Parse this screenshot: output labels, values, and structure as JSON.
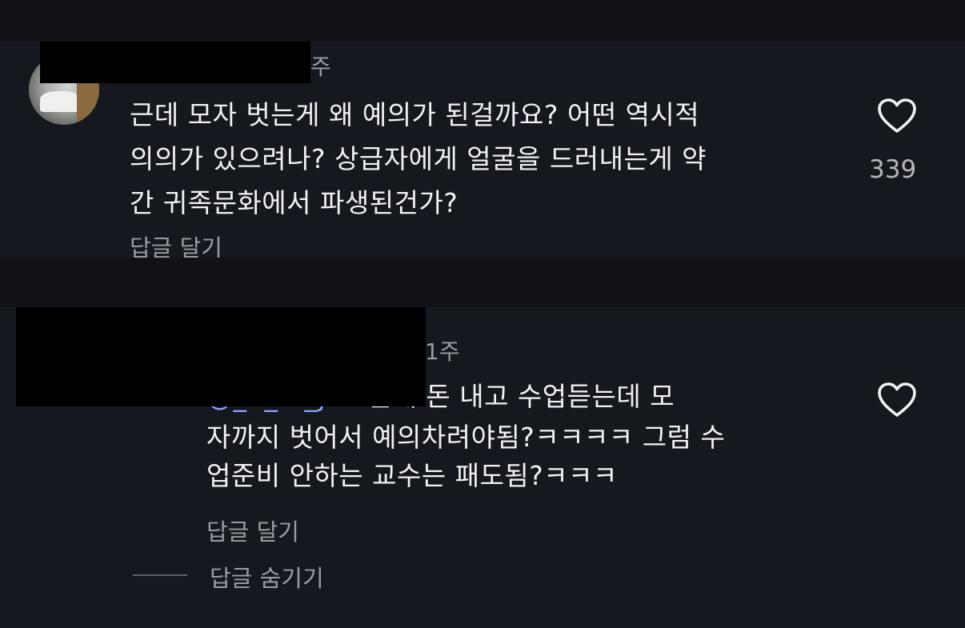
{
  "comments": [
    {
      "time": "주",
      "lines": [
        "근데 모자 벗는게 왜 예의가 된걸까요?  어떤 역시적",
        "의의가 있으려나?  상급자에게 얼굴을 드러내는게 약",
        "간 귀족문화에서 파생된건가?"
      ],
      "reply_label": "답글 달기",
      "likes": "339",
      "like_icon": "heart-outline-icon"
    },
    {
      "time": "1주",
      "mention": "@_.._..._jae",
      "lines": [
        "근데 돈 내고 수업듣는데 모",
        "자까지 벗어서 예의차려야됨?ㅋㅋㅋㅋ 그럼 수",
        "업준비 안하는 교수는 패도됨?ㅋㅋㅋ"
      ],
      "reply_label": "답글 달기",
      "hide_label": "답글 숨기기",
      "like_icon": "heart-outline-icon"
    }
  ],
  "colors": {
    "background": "#101217",
    "panel": "#15181e",
    "text": "#f1f2f4",
    "muted": "#9a9ca3",
    "mention": "#8fa3ff"
  }
}
